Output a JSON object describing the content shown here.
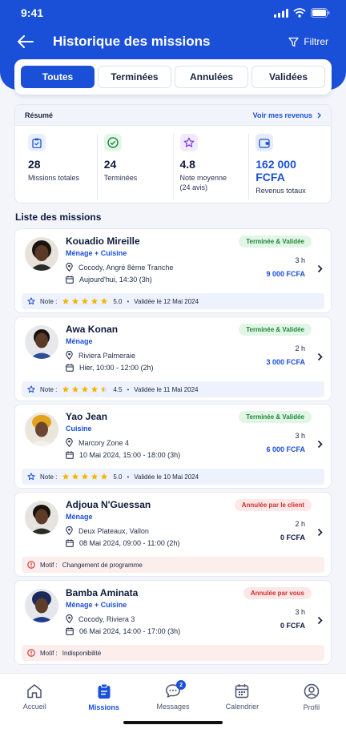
{
  "status": {
    "time": "9:41"
  },
  "header": {
    "title": "Historique des missions",
    "filter_label": "Filtrer"
  },
  "tabs": [
    {
      "label": "Toutes",
      "active": true
    },
    {
      "label": "Terminées",
      "active": false
    },
    {
      "label": "Annulées",
      "active": false
    },
    {
      "label": "Validées",
      "active": false
    }
  ],
  "summary": {
    "label": "Résumé",
    "link": "Voir mes revenus",
    "stats": [
      {
        "icon": "clipboard-icon",
        "value": "28",
        "label": "Missions totales"
      },
      {
        "icon": "check-circle-icon",
        "value": "24",
        "label": "Terminées"
      },
      {
        "icon": "star-icon",
        "value": "4.8",
        "label": "Note moyenne",
        "sub": "(24 avis)"
      },
      {
        "icon": "wallet-icon",
        "value": "162 000 FCFA",
        "label": "Revenus totaux"
      }
    ]
  },
  "list_title": "Liste des missions",
  "missions": [
    {
      "name": "Kouadio Mireille",
      "type": "Ménage + Cuisine",
      "location": "Cocody, Angré 8ème Tranche",
      "date": "Aujourd'hui, 14:30 (3h)",
      "status": "Terminée & Validée",
      "status_color": "#1e8a3a",
      "hours": "3 h",
      "price": "9 000 FCFA",
      "foot_kind": "rating",
      "note_label": "Note :",
      "rating": 5.0,
      "rating_text": "5.0",
      "foot_text": "Validée le 12 Mai 2024"
    },
    {
      "name": "Awa Konan",
      "type": "Ménage",
      "location": "Riviera Palmeraie",
      "date": "Hier, 10:00 - 12:00 (2h)",
      "status": "Terminée & Validée",
      "status_color": "#1e8a3a",
      "hours": "2 h",
      "price": "3 000 FCFA",
      "foot_kind": "rating",
      "note_label": "Note :",
      "rating": 4.5,
      "rating_text": "4.5",
      "foot_text": "Validée le 11 Mai 2024"
    },
    {
      "name": "Yao Jean",
      "type": "Cuisine",
      "location": "Marcory Zone 4",
      "date": "10 Mai 2024, 15:00 - 18:00 (3h)",
      "status": "Terminée & Validée",
      "status_color": "#1e8a3a",
      "hours": "3 h",
      "price": "6 000 FCFA",
      "foot_kind": "rating",
      "note_label": "Note :",
      "rating": 5.0,
      "rating_text": "5.0",
      "foot_text": "Validée le 10 Mai 2024"
    },
    {
      "name": "Adjoua N'Guessan",
      "type": "Ménage",
      "location": "Deux Plateaux, Vallon",
      "date": "08 Mai 2024, 09:00 - 11:00 (2h)",
      "status": "Annulée par le client",
      "status_color": "#cf2e2e",
      "hours": "2 h",
      "price": "0 FCFA",
      "foot_kind": "reason",
      "note_label": "Motif :",
      "foot_text": "Changement de programme"
    },
    {
      "name": "Bamba Aminata",
      "type": "Ménage + Cuisine",
      "location": "Cocody, Riviera 3",
      "date": "06 Mai 2024, 14:00 - 17:00 (3h)",
      "status": "Annulée par vous",
      "status_color": "#cf2e2e",
      "hours": "3 h",
      "price": "0 FCFA",
      "foot_kind": "reason",
      "note_label": "Motif :",
      "foot_text": "Indisponibilité"
    }
  ],
  "nav": [
    {
      "label": "Accueil",
      "icon": "home-icon",
      "active": false
    },
    {
      "label": "Missions",
      "icon": "clipboard-icon",
      "active": true
    },
    {
      "label": "Messages",
      "icon": "chat-icon",
      "active": false,
      "badge": "2"
    },
    {
      "label": "Calendrier",
      "icon": "calendar-icon",
      "active": false
    },
    {
      "label": "Profil",
      "icon": "user-icon",
      "active": false
    }
  ],
  "colors": {
    "primary": "#1a4fd8",
    "success": "#1e8a3a",
    "danger": "#cf2e2e",
    "star": "#f5b301"
  }
}
